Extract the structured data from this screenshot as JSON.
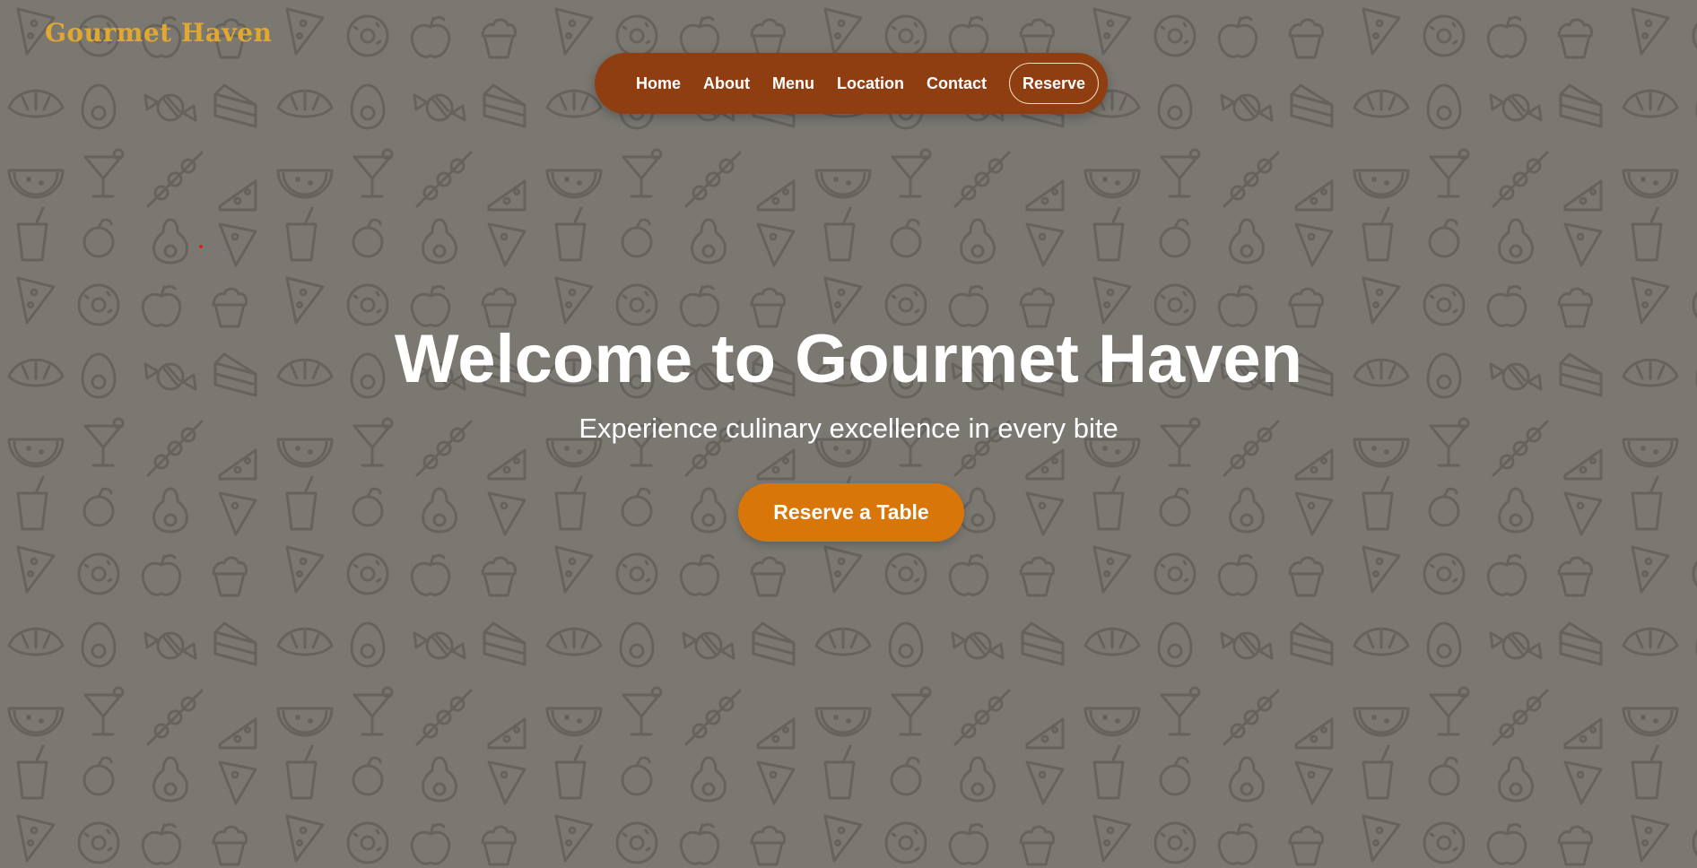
{
  "brand": {
    "name": "Gourmet Haven",
    "color": "#e0a830"
  },
  "nav": {
    "links": [
      "Home",
      "About",
      "Menu",
      "Location",
      "Contact"
    ],
    "reserve_label": "Reserve",
    "background": "#8e3e10"
  },
  "hero": {
    "title": "Welcome to Gourmet Haven",
    "subtitle": "Experience culinary excellence in every bite",
    "cta_label": "Reserve a Table",
    "cta_color": "#d9760a"
  },
  "background": {
    "base_color": "#7b7872",
    "pattern_color": "#66625d",
    "pattern_icons": [
      "pizza-slice-icon",
      "donut-icon",
      "apple-icon",
      "cupcake-icon",
      "croissant-icon",
      "avocado-icon",
      "candy-icon",
      "cake-slice-icon",
      "watermelon-icon",
      "cocktail-icon",
      "skewer-icon",
      "cheese-icon",
      "drink-cup-icon",
      "orange-icon"
    ]
  },
  "cursor_color": "#e02020"
}
